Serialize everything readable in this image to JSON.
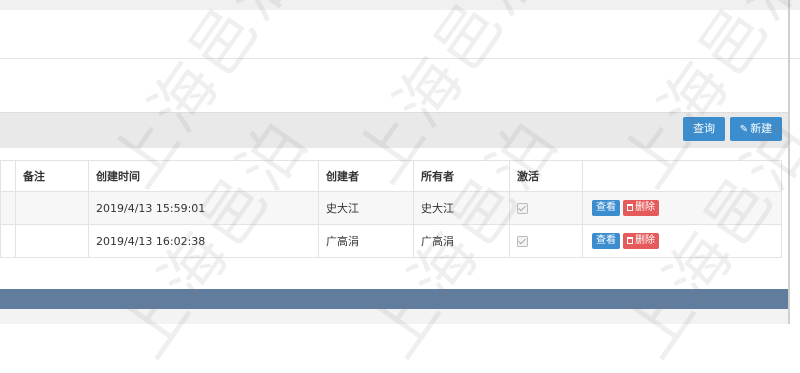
{
  "toolbar": {
    "query_label": "查询",
    "new_label": "新建",
    "new_icon": "pencil-icon"
  },
  "table": {
    "headers": [
      "备注",
      "创建时间",
      "创建者",
      "所有者",
      "激活",
      ""
    ],
    "rows": [
      {
        "note": "",
        "created": "2019/4/13 15:59:01",
        "creator": "史大江",
        "owner": "史大江",
        "active": true
      },
      {
        "note": "",
        "created": "2019/4/13 16:02:38",
        "creator": "广高涓",
        "owner": "广高涓",
        "active": true
      }
    ],
    "actions": {
      "view_label": "查看",
      "delete_label": "删除",
      "delete_icon": "trash-icon"
    }
  },
  "watermark": "上海邑泊",
  "colors": {
    "primary": "#3c8dce",
    "danger": "#e55a5a",
    "footer": "#617d9d"
  }
}
